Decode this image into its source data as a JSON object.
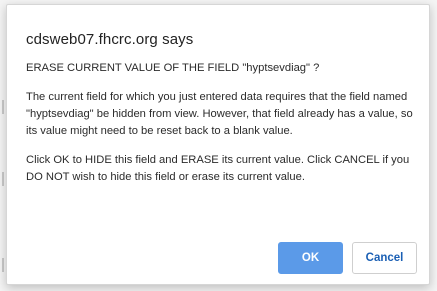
{
  "dialog": {
    "title": "cdsweb07.fhcrc.org says",
    "messages": [
      "ERASE CURRENT VALUE OF THE FIELD \"hyptsevdiag\" ?",
      "The current field for which you just entered data requires that the field named \"hyptsevdiag\" be hidden from view. However, that field already has a value, so its value might need to be reset back to a blank value.",
      "Click OK to HIDE this field and ERASE its current value. Click CANCEL if you DO NOT wish to hide this field or erase its current value."
    ],
    "ok_label": "OK",
    "cancel_label": "Cancel"
  },
  "colors": {
    "ok_button_background": "#5b9ae8",
    "cancel_button_text": "#1a5fb4",
    "dialog_background": "#ffffff"
  }
}
